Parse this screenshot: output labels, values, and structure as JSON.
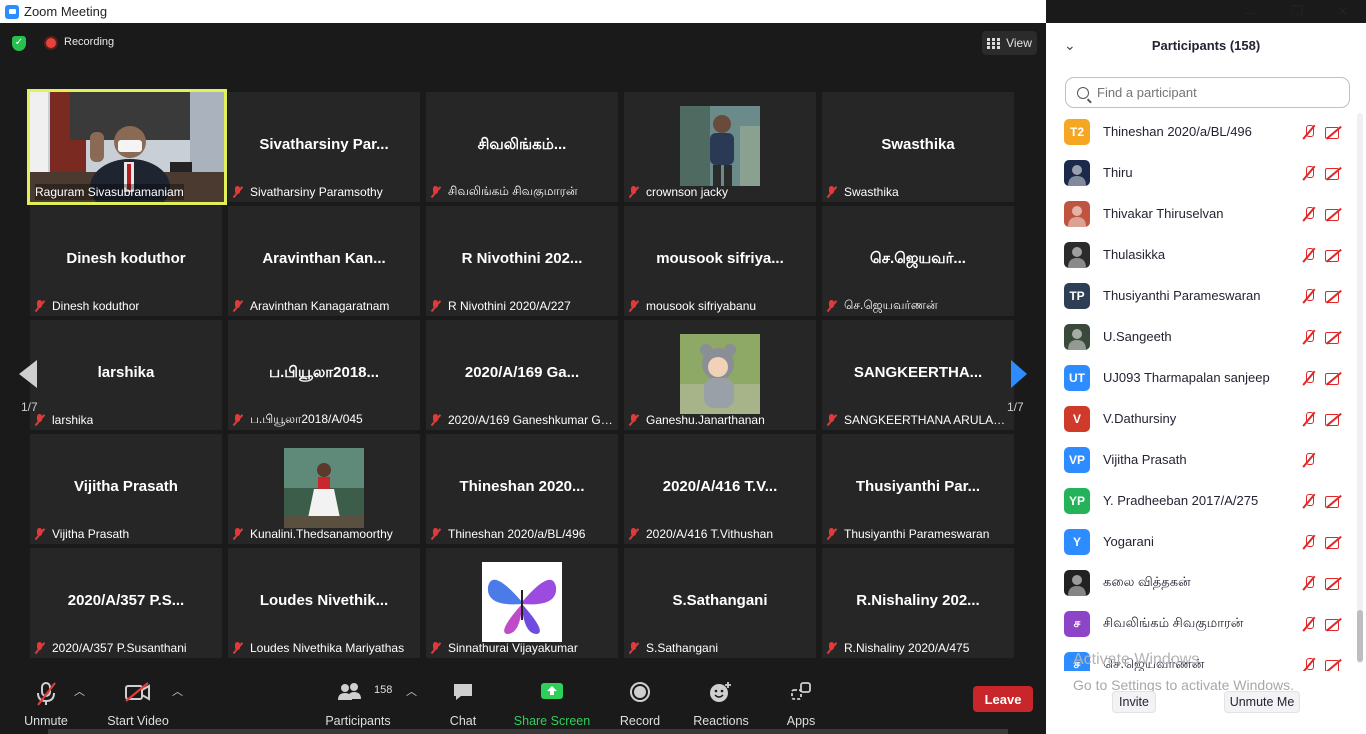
{
  "window": {
    "title": "Zoom Meeting",
    "controls": [
      "—",
      "❐",
      "✕"
    ]
  },
  "topbar": {
    "recording_label": "Recording",
    "view_label": "View"
  },
  "pager": {
    "left_label": "1/7",
    "right_label": "1/7"
  },
  "tiles": [
    {
      "big": "",
      "label": "Raguram Sivasubramaniam",
      "type": "video",
      "active": true
    },
    {
      "big": "Sivatharsiny  Par...",
      "label": "Sivatharsiny Paramsothy"
    },
    {
      "big": "சிவலிங்கம்...",
      "label": "சிவலிங்கம் சிவகுமாரன்"
    },
    {
      "big": "",
      "label": "crownson jacky",
      "type": "photo",
      "photo": "person"
    },
    {
      "big": "Swasthika",
      "label": "Swasthika"
    },
    {
      "big": "Dinesh koduthor",
      "label": "Dinesh koduthor"
    },
    {
      "big": "Aravinthan  Kan...",
      "label": "Aravinthan Kanagaratnam"
    },
    {
      "big": "R Nivothini 202...",
      "label": "R Nivothini 2020/A/227"
    },
    {
      "big": "mousook  sifriya...",
      "label": "mousook sifriyabanu"
    },
    {
      "big": "செ.ஜெயவர்...",
      "label": "செ.ஜெயவர்ணன்"
    },
    {
      "big": "larshika",
      "label": "larshika"
    },
    {
      "big": "ப.பியூலா2018...",
      "label": "ப.பியூலா2018/A/045"
    },
    {
      "big": "2020/A/169 Ga...",
      "label": "2020/A/169 Ganeshkumar Gowsika"
    },
    {
      "big": "",
      "label": "Ganeshu.Janarthanan",
      "type": "photo",
      "photo": "baby"
    },
    {
      "big": "SANGKEERTHA...",
      "label": "SANGKEERTHANA ARULANANTHAN"
    },
    {
      "big": "Vijitha Prasath",
      "label": "Vijitha Prasath"
    },
    {
      "big": "",
      "label": "Kunalini.Thedsanamoorthy",
      "type": "photo",
      "photo": "girl"
    },
    {
      "big": "Thineshan 2020...",
      "label": "Thineshan 2020/a/BL/496"
    },
    {
      "big": "2020/A/416  T.V...",
      "label": "2020/A/416  T.Vithushan"
    },
    {
      "big": "Thusiyanthi  Par...",
      "label": "Thusiyanthi Parameswaran"
    },
    {
      "big": "2020/A/357 P.S...",
      "label": "2020/A/357 P.Susanthani"
    },
    {
      "big": "Loudes  Nivethik...",
      "label": "Loudes Nivethika Mariyathas"
    },
    {
      "big": "",
      "label": "Sinnathurai Vijayakumar",
      "type": "photo",
      "photo": "butterfly"
    },
    {
      "big": "S.Sathangani",
      "label": "S.Sathangani"
    },
    {
      "big": "R.Nishaliny  202...",
      "label": "R.Nishaliny 2020/A/475"
    }
  ],
  "toolbar": {
    "unmute": "Unmute",
    "start_video": "Start Video",
    "participants_count": "158",
    "participants": "Participants",
    "chat": "Chat",
    "share_screen": "Share Screen",
    "record": "Record",
    "reactions": "Reactions",
    "apps": "Apps",
    "leave": "Leave"
  },
  "panel": {
    "title": "Participants (158)",
    "search_placeholder": "Find a participant",
    "participants": [
      {
        "initials": "T2",
        "name": "Thineshan 2020/a/BL/496",
        "color": "#F5A623",
        "cam": true
      },
      {
        "initials": "",
        "name": "Thiru",
        "color": "#1b2a4a",
        "cam": true
      },
      {
        "initials": "",
        "name": "Thivakar Thiruselvan",
        "color": "#c0553f",
        "cam": true
      },
      {
        "initials": "",
        "name": "Thulasikka",
        "color": "#2b2b2b",
        "cam": true
      },
      {
        "initials": "TP",
        "name": "Thusiyanthi Parameswaran",
        "color": "#2e3f55",
        "cam": true
      },
      {
        "initials": "",
        "name": "U.Sangeeth",
        "color": "#3a4a3a",
        "cam": true
      },
      {
        "initials": "UT",
        "name": "UJ093 Tharmapalan sanjeep",
        "color": "#2D8CFF",
        "cam": true
      },
      {
        "initials": "V",
        "name": "V.Dathursiny",
        "color": "#d03a2b",
        "cam": true
      },
      {
        "initials": "VP",
        "name": "Vijitha Prasath",
        "color": "#2D8CFF",
        "cam": false
      },
      {
        "initials": "YP",
        "name": "Y. Pradheeban 2017/A/275",
        "color": "#25b35a",
        "cam": true
      },
      {
        "initials": "Y",
        "name": "Yogarani",
        "color": "#2D8CFF",
        "cam": true
      },
      {
        "initials": "",
        "name": "கலை வித்தகன்",
        "color": "#222222",
        "cam": true
      },
      {
        "initials": "ச",
        "name": "சிவலிங்கம் சிவகுமாரன்",
        "color": "#8e44c9",
        "cam": true
      },
      {
        "initials": "ச",
        "name": "செ.ஜெயவர்ணன்",
        "color": "#2D8CFF",
        "cam": true
      }
    ],
    "watermark_line1": "Activate Windows",
    "watermark_line2": "Go to Settings to activate Windows.",
    "invite": "Invite",
    "unmute_me": "Unmute Me"
  },
  "colors": {
    "accent": "#2D8CFF",
    "active_border": "#e2f15a",
    "leave": "#c8262b",
    "muted": "#e03b3b",
    "share_green": "#2fd05a"
  }
}
